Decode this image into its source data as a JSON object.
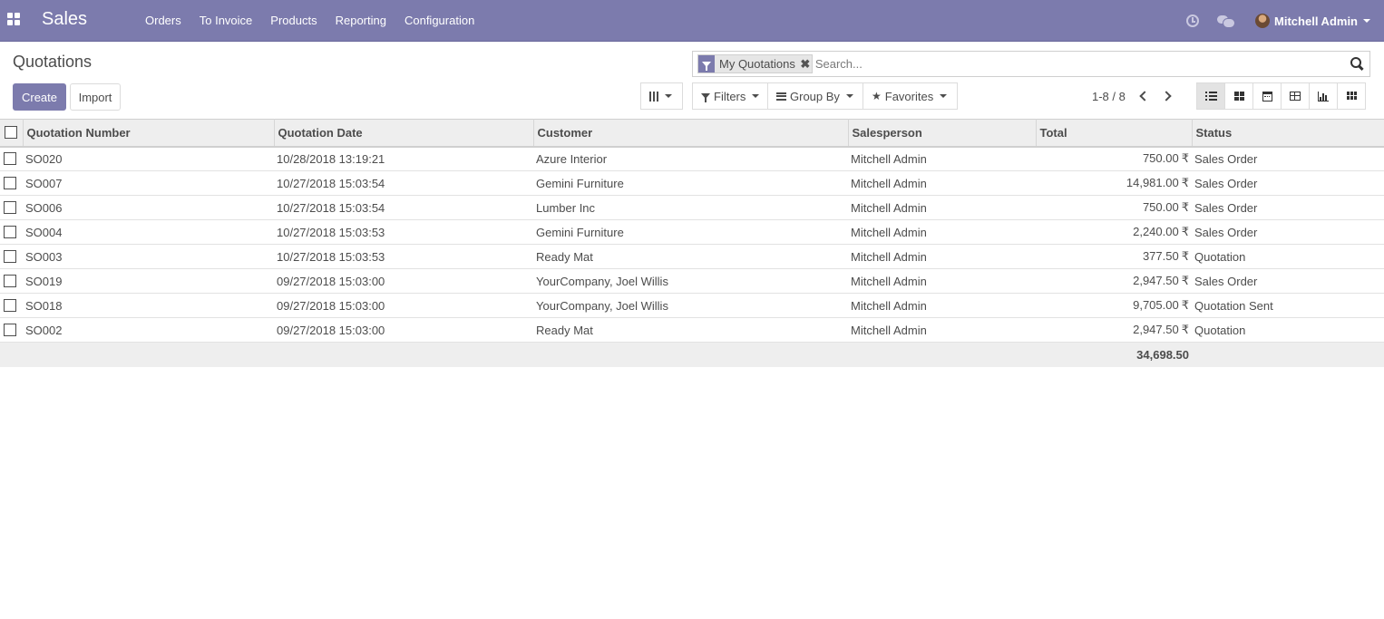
{
  "navbar": {
    "brand": "Sales",
    "menu": [
      "Orders",
      "To Invoice",
      "Products",
      "Reporting",
      "Configuration"
    ],
    "user": "Mitchell Admin",
    "accent_color": "#7c7bad"
  },
  "control_panel": {
    "breadcrumb": "Quotations",
    "create_label": "Create",
    "import_label": "Import",
    "search": {
      "facet_label": "My Quotations",
      "placeholder": "Search..."
    },
    "filters_label": "Filters",
    "group_by_label": "Group By",
    "favorites_label": "Favorites",
    "pager": "1-8 / 8",
    "views": [
      "list",
      "kanban",
      "calendar",
      "pivot",
      "graph",
      "grid"
    ],
    "active_view": "list"
  },
  "table": {
    "columns": [
      "Quotation Number",
      "Quotation Date",
      "Customer",
      "Salesperson",
      "Total",
      "Status"
    ],
    "currency_symbol": "₹",
    "rows": [
      {
        "number": "SO020",
        "date": "10/28/2018 13:19:21",
        "customer": "Azure Interior",
        "salesperson": "Mitchell Admin",
        "total": "750.00",
        "status": "Sales Order"
      },
      {
        "number": "SO007",
        "date": "10/27/2018 15:03:54",
        "customer": "Gemini Furniture",
        "salesperson": "Mitchell Admin",
        "total": "14,981.00",
        "status": "Sales Order"
      },
      {
        "number": "SO006",
        "date": "10/27/2018 15:03:54",
        "customer": "Lumber Inc",
        "salesperson": "Mitchell Admin",
        "total": "750.00",
        "status": "Sales Order"
      },
      {
        "number": "SO004",
        "date": "10/27/2018 15:03:53",
        "customer": "Gemini Furniture",
        "salesperson": "Mitchell Admin",
        "total": "2,240.00",
        "status": "Sales Order"
      },
      {
        "number": "SO003",
        "date": "10/27/2018 15:03:53",
        "customer": "Ready Mat",
        "salesperson": "Mitchell Admin",
        "total": "377.50",
        "status": "Quotation"
      },
      {
        "number": "SO019",
        "date": "09/27/2018 15:03:00",
        "customer": "YourCompany, Joel Willis",
        "salesperson": "Mitchell Admin",
        "total": "2,947.50",
        "status": "Sales Order"
      },
      {
        "number": "SO018",
        "date": "09/27/2018 15:03:00",
        "customer": "YourCompany, Joel Willis",
        "salesperson": "Mitchell Admin",
        "total": "9,705.00",
        "status": "Quotation Sent"
      },
      {
        "number": "SO002",
        "date": "09/27/2018 15:03:00",
        "customer": "Ready Mat",
        "salesperson": "Mitchell Admin",
        "total": "2,947.50",
        "status": "Quotation"
      }
    ],
    "footer_total": "34,698.50"
  }
}
